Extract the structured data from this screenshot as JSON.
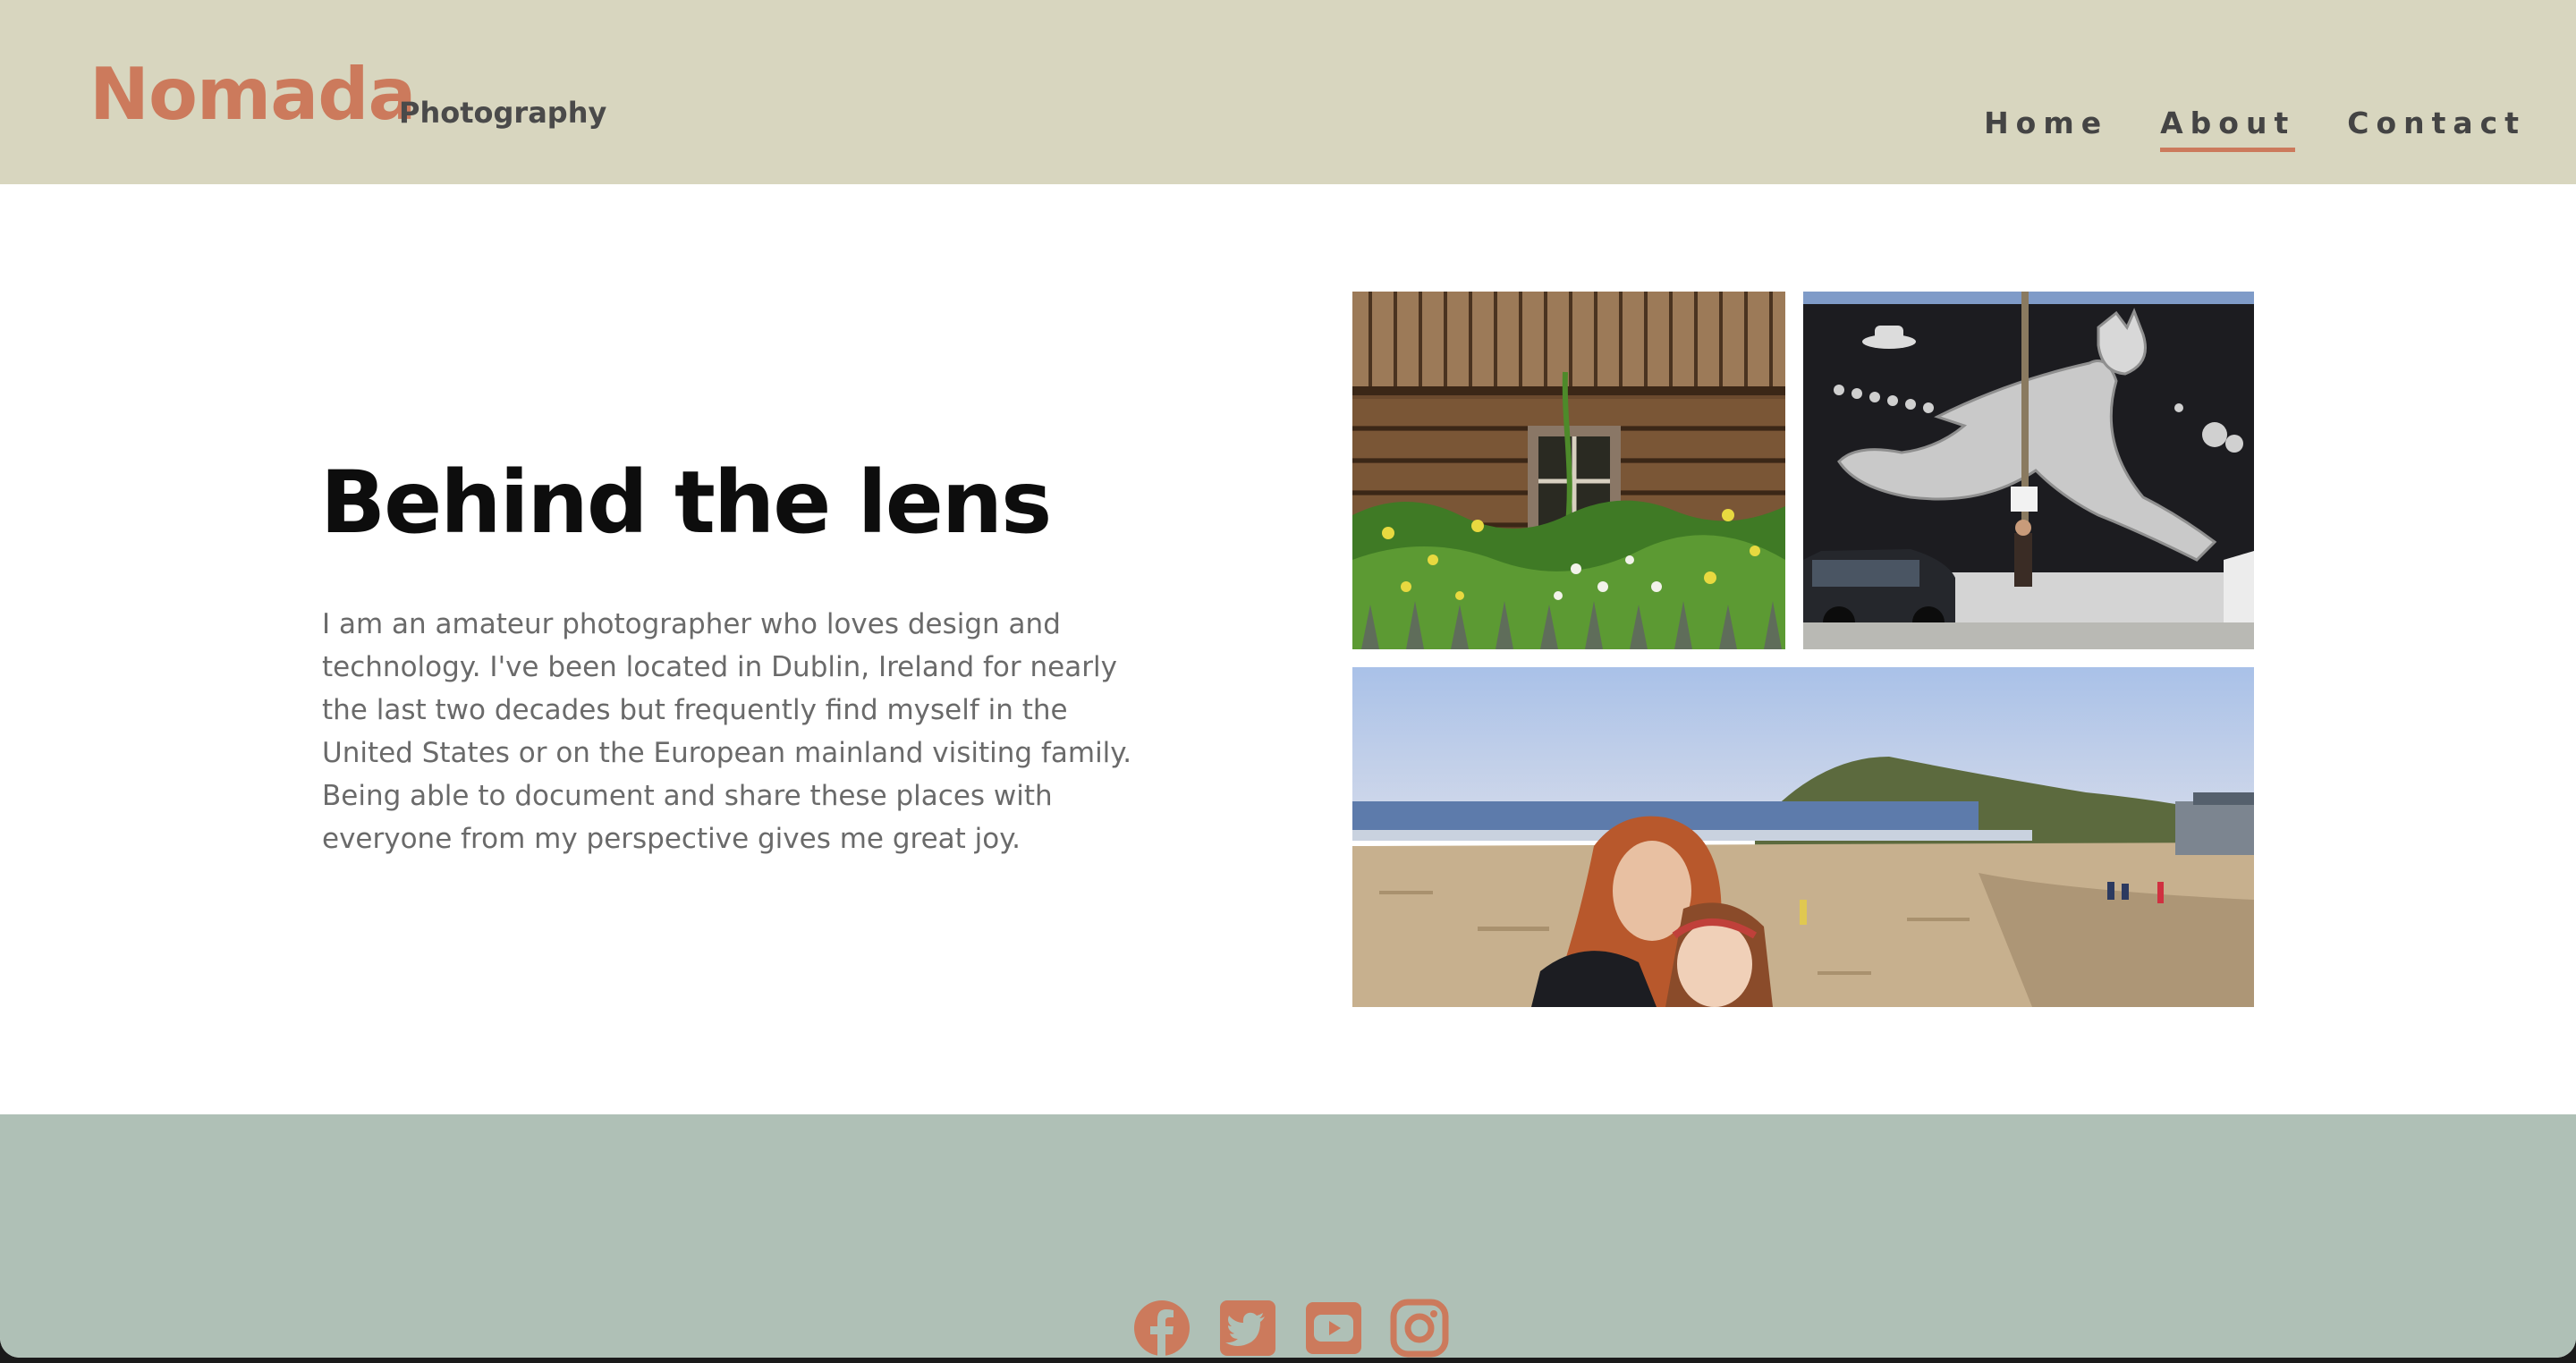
{
  "header": {
    "logo": "Nomada",
    "logo_subtitle": "Photography",
    "nav": [
      {
        "label": "Home",
        "active": false
      },
      {
        "label": "About",
        "active": true
      },
      {
        "label": "Contact",
        "active": false
      }
    ]
  },
  "about": {
    "title": "Behind the lens",
    "bio": "I am an amateur photographer who loves design and technology. I've been located in Dublin, Ireland for nearly the last two decades but frequently find myself in the United States or on the European mainland visiting family. Being able to document and share these places with everyone from my perspective gives me great joy."
  },
  "gallery": [
    {
      "icon": "wooden-cabin-photo"
    },
    {
      "icon": "street-mural-photo"
    },
    {
      "icon": "beach-selfie-photo"
    }
  ],
  "footer": {
    "social": [
      "facebook-icon",
      "twitter-icon",
      "youtube-icon",
      "instagram-icon"
    ]
  },
  "colors": {
    "accent": "#cc7a5c",
    "header_bg": "#d8d6bf",
    "footer_bg": "#afc0b6",
    "text_dark": "#0d0d0d",
    "text_body": "#6a6a6a"
  }
}
